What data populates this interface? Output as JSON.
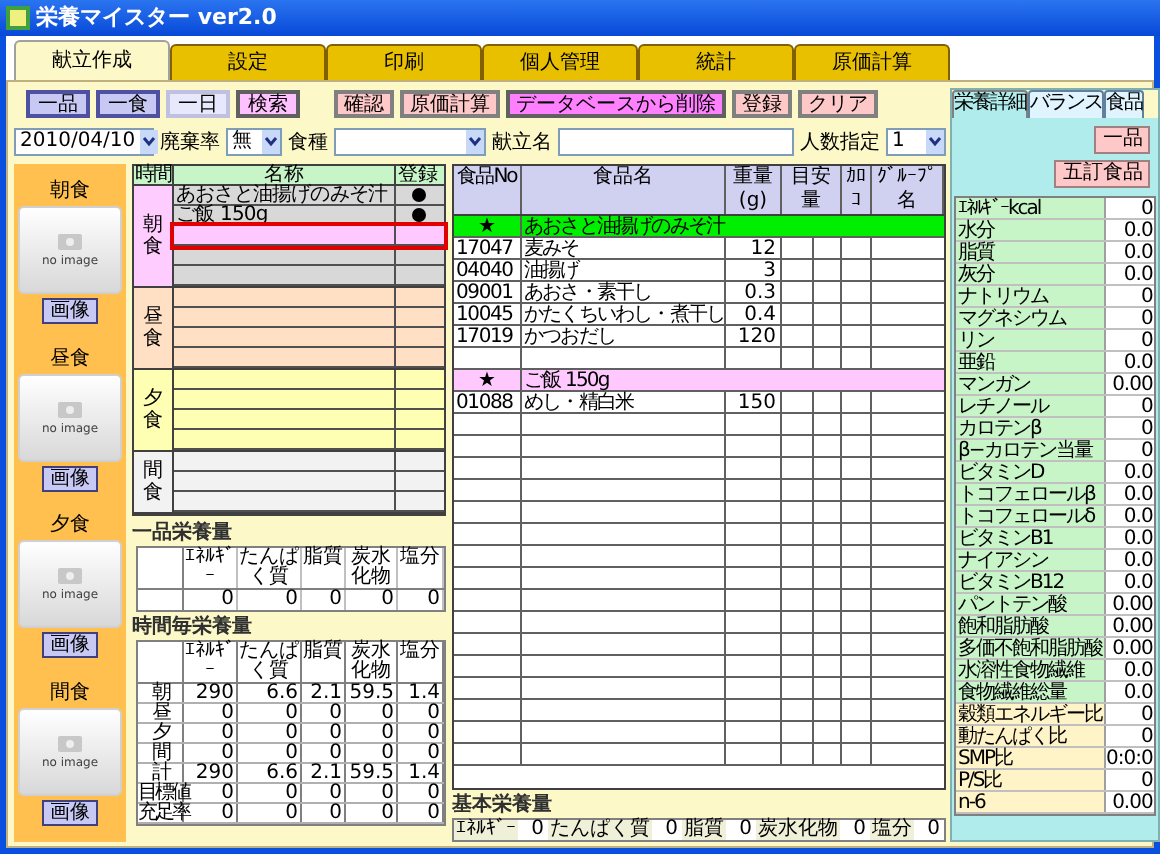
{
  "window": {
    "title": "栄養マイスター ver2.0"
  },
  "tabs": [
    {
      "label": "献立作成",
      "selected": true
    },
    {
      "label": "設定",
      "selected": false
    },
    {
      "label": "印刷",
      "selected": false
    },
    {
      "label": "個人管理",
      "selected": false
    },
    {
      "label": "統計",
      "selected": false
    },
    {
      "label": "原価計算",
      "selected": false
    }
  ],
  "toolbar": [
    {
      "label": "一品",
      "kind": "mode",
      "selected": false
    },
    {
      "label": "一食",
      "kind": "mode",
      "selected": false
    },
    {
      "label": "一日",
      "kind": "mode",
      "selected": true
    },
    {
      "label": "検索",
      "kind": "search"
    },
    {
      "label": "確認",
      "kind": "action"
    },
    {
      "label": "原価計算",
      "kind": "action"
    },
    {
      "label": "データベースから削除",
      "kind": "delete"
    },
    {
      "label": "登録",
      "kind": "action"
    },
    {
      "label": "クリア",
      "kind": "action"
    }
  ],
  "filters": {
    "date": "2010/04/10",
    "waste_label": "廃棄率",
    "waste": "無",
    "meal_type_label": "食種",
    "menu_name_label": "献立名",
    "servings_label": "人数指定",
    "servings": "1"
  },
  "meal_images": [
    {
      "label": "朝食",
      "image_text": "no image",
      "button": "画像"
    },
    {
      "label": "昼食",
      "image_text": "no image",
      "button": "画像"
    },
    {
      "label": "夕食",
      "image_text": "no image",
      "button": "画像"
    },
    {
      "label": "間食",
      "image_text": "no image",
      "button": "画像"
    }
  ],
  "meal_table": {
    "columns": [
      "時間",
      "名称",
      "登録"
    ],
    "sections": [
      {
        "label": "朝食",
        "color": "#ffccff",
        "selected": true,
        "rows": [
          {
            "name": "あおさと油揚げのみそ汁",
            "registered": true,
            "selected": false
          },
          {
            "name": "ご飯 150g",
            "registered": true,
            "selected": false
          },
          {
            "registered": false,
            "selected": true
          },
          {
            "registered": false,
            "selected": false
          },
          {
            "registered": false,
            "selected": false
          }
        ]
      },
      {
        "label": "昼食",
        "color": "#ffe0c4",
        "selected": false,
        "rows": [
          {
            "registered": false,
            "selected": false
          },
          {
            "registered": false,
            "selected": false
          },
          {
            "registered": false,
            "selected": false
          },
          {
            "registered": false,
            "selected": false
          }
        ]
      },
      {
        "label": "夕食",
        "color": "#ffffb4",
        "selected": false,
        "rows": [
          {
            "registered": false,
            "selected": false
          },
          {
            "registered": false,
            "selected": false
          },
          {
            "registered": false,
            "selected": false
          },
          {
            "registered": false,
            "selected": false
          }
        ]
      },
      {
        "label": "間食",
        "color": "#f2f2f2",
        "selected": false,
        "rows": [
          {
            "registered": false,
            "selected": false
          },
          {
            "registered": false,
            "selected": false
          },
          {
            "registered": false,
            "selected": false
          }
        ]
      }
    ]
  },
  "item_nutrition": {
    "title": "一品栄養量",
    "columns": [
      "ｴﾈﾙｷﾞｰ",
      "たんぱく質",
      "脂質",
      "炭水化物",
      "塩分"
    ],
    "values": [
      "0",
      "0",
      "0",
      "0",
      "0"
    ]
  },
  "time_nutrition": {
    "title": "時間毎栄養量",
    "columns": [
      "ｴﾈﾙｷﾞｰ",
      "たんぱく質",
      "脂質",
      "炭水化物",
      "塩分"
    ],
    "rows": [
      {
        "label": "朝",
        "values": [
          "290",
          "6.6",
          "2.1",
          "59.5",
          "1.4"
        ]
      },
      {
        "label": "昼",
        "values": [
          "0",
          "0",
          "0",
          "0",
          "0"
        ]
      },
      {
        "label": "夕",
        "values": [
          "0",
          "0",
          "0",
          "0",
          "0"
        ]
      },
      {
        "label": "間",
        "values": [
          "0",
          "0",
          "0",
          "0",
          "0"
        ]
      },
      {
        "label": "計",
        "values": [
          "290",
          "6.6",
          "2.1",
          "59.5",
          "1.4"
        ]
      },
      {
        "label": "目標値",
        "values": [
          "0",
          "0",
          "0",
          "0",
          "0"
        ]
      },
      {
        "label": "充足率",
        "values": [
          "0",
          "0",
          "0",
          "0",
          "0"
        ]
      }
    ]
  },
  "food_table": {
    "columns": [
      "食品No",
      "食品名",
      "重量(g)",
      "目安量",
      "ｶﾛｺ",
      "ｸﾞﾙｰﾌﾟ名"
    ],
    "rows": [
      {
        "kind": "dish",
        "mark": "★",
        "name": "あおさと油揚げのみそ汁",
        "color": "#00ee00"
      },
      {
        "kind": "food",
        "no": "17047",
        "name": "麦みそ",
        "weight": "12"
      },
      {
        "kind": "food",
        "no": "04040",
        "name": "油揚げ",
        "weight": "3"
      },
      {
        "kind": "food",
        "no": "09001",
        "name": "あおさ・素干し",
        "weight": "0.3"
      },
      {
        "kind": "food",
        "no": "10045",
        "name": "かたくちいわし・煮干し",
        "weight": "0.4"
      },
      {
        "kind": "food",
        "no": "17019",
        "name": "かつおだし",
        "weight": "120"
      },
      {
        "kind": "blank"
      },
      {
        "kind": "dish",
        "mark": "★",
        "name": "ご飯 150g",
        "color": "#ffc8ff"
      },
      {
        "kind": "food",
        "no": "01088",
        "name": "めし・精白米",
        "weight": "150"
      }
    ]
  },
  "basic_nutrition": {
    "title": "基本栄養量",
    "items": [
      {
        "label": "ｴﾈﾙｷﾞｰ",
        "value": "0"
      },
      {
        "label": "たんぱく質",
        "value": "0"
      },
      {
        "label": "脂質",
        "value": "0"
      },
      {
        "label": "炭水化物",
        "value": "0"
      },
      {
        "label": "塩分",
        "value": "0"
      }
    ]
  },
  "side_panel": {
    "tabs": [
      {
        "label": "栄養詳細",
        "selected": true
      },
      {
        "label": "バランス",
        "selected": false
      },
      {
        "label": "食品",
        "selected": false
      }
    ],
    "buttons": [
      "一品",
      "五訂食品"
    ],
    "nutrients": [
      {
        "name": "ｴﾈﾙｷﾞｰkcal",
        "value": "0",
        "color": "#c8f5c8"
      },
      {
        "name": "水分",
        "value": "0.0",
        "color": "#c8f5c8"
      },
      {
        "name": "脂質",
        "value": "0.0",
        "color": "#c8f5c8"
      },
      {
        "name": "灰分",
        "value": "0.0",
        "color": "#c8f5c8"
      },
      {
        "name": "ナトリウム",
        "value": "0",
        "color": "#c8f5c8"
      },
      {
        "name": "マグネシウム",
        "value": "0",
        "color": "#c8f5c8"
      },
      {
        "name": "リン",
        "value": "0",
        "color": "#c8f5c8"
      },
      {
        "name": "亜鉛",
        "value": "0.0",
        "color": "#c8f5c8"
      },
      {
        "name": "マンガン",
        "value": "0.00",
        "color": "#c8f5c8"
      },
      {
        "name": "レチノール",
        "value": "0",
        "color": "#c8f5c8"
      },
      {
        "name": "カロテンβ",
        "value": "0",
        "color": "#c8f5c8"
      },
      {
        "name": "β−カロテン当量",
        "value": "0",
        "color": "#c8f5c8"
      },
      {
        "name": "ビタミンD",
        "value": "0.0",
        "color": "#c8f5c8"
      },
      {
        "name": "トコフェロールβ",
        "value": "0.0",
        "color": "#c8f5c8"
      },
      {
        "name": "トコフェロールδ",
        "value": "0.0",
        "color": "#c8f5c8"
      },
      {
        "name": "ビタミンB1",
        "value": "0.0",
        "color": "#c8f5c8"
      },
      {
        "name": "ナイアシン",
        "value": "0.0",
        "color": "#c8f5c8"
      },
      {
        "name": "ビタミンB12",
        "value": "0.0",
        "color": "#c8f5c8"
      },
      {
        "name": "パントテン酸",
        "value": "0.00",
        "color": "#c8f5c8"
      },
      {
        "name": "飽和脂肪酸",
        "value": "0.00",
        "color": "#c8f5c8"
      },
      {
        "name": "多価不飽和脂肪酸",
        "value": "0.00",
        "color": "#c8f5c8"
      },
      {
        "name": "水溶性食物繊維",
        "value": "0.0",
        "color": "#c8f5c8"
      },
      {
        "name": "食物繊維総量",
        "value": "0.0",
        "color": "#c8f5c8"
      },
      {
        "name": "穀類エネルギー比",
        "value": "0",
        "color": "#fff3c8"
      },
      {
        "name": "動たんぱく比",
        "value": "0",
        "color": "#fff3c8"
      },
      {
        "name": "SMP比",
        "value": "0:0:0",
        "color": "#fff3c8"
      },
      {
        "name": "P/S比",
        "value": "0",
        "color": "#fff3c8"
      },
      {
        "name": "n-6",
        "value": "0.00",
        "color": "#fff3c8"
      }
    ]
  }
}
